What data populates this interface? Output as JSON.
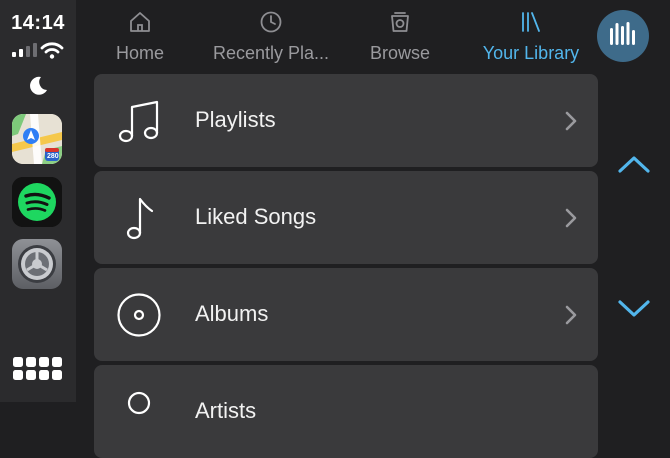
{
  "status": {
    "time": "14:14"
  },
  "dock": {
    "apps": [
      {
        "name": "Maps",
        "icon": "maps-icon"
      },
      {
        "name": "Spotify",
        "icon": "spotify-icon"
      },
      {
        "name": "Settings",
        "icon": "settings-icon"
      }
    ],
    "maps_badge": "280"
  },
  "tabs": [
    {
      "label": "Home",
      "icon": "home-icon",
      "active": false
    },
    {
      "label": "Recently Pla...",
      "icon": "clock-icon",
      "active": false
    },
    {
      "label": "Browse",
      "icon": "browse-icon",
      "active": false
    },
    {
      "label": "Your Library",
      "icon": "library-icon",
      "active": true
    }
  ],
  "library": {
    "items": [
      {
        "label": "Playlists",
        "icon": "music-notes-icon"
      },
      {
        "label": "Liked Songs",
        "icon": "music-note-icon"
      },
      {
        "label": "Albums",
        "icon": "album-icon"
      },
      {
        "label": "Artists",
        "icon": "artist-icon"
      }
    ]
  },
  "colors": {
    "accent": "#52b6ec",
    "row": "#3a3a3c",
    "background": "#1f1f21",
    "sidebar": "#2b2b2d"
  }
}
